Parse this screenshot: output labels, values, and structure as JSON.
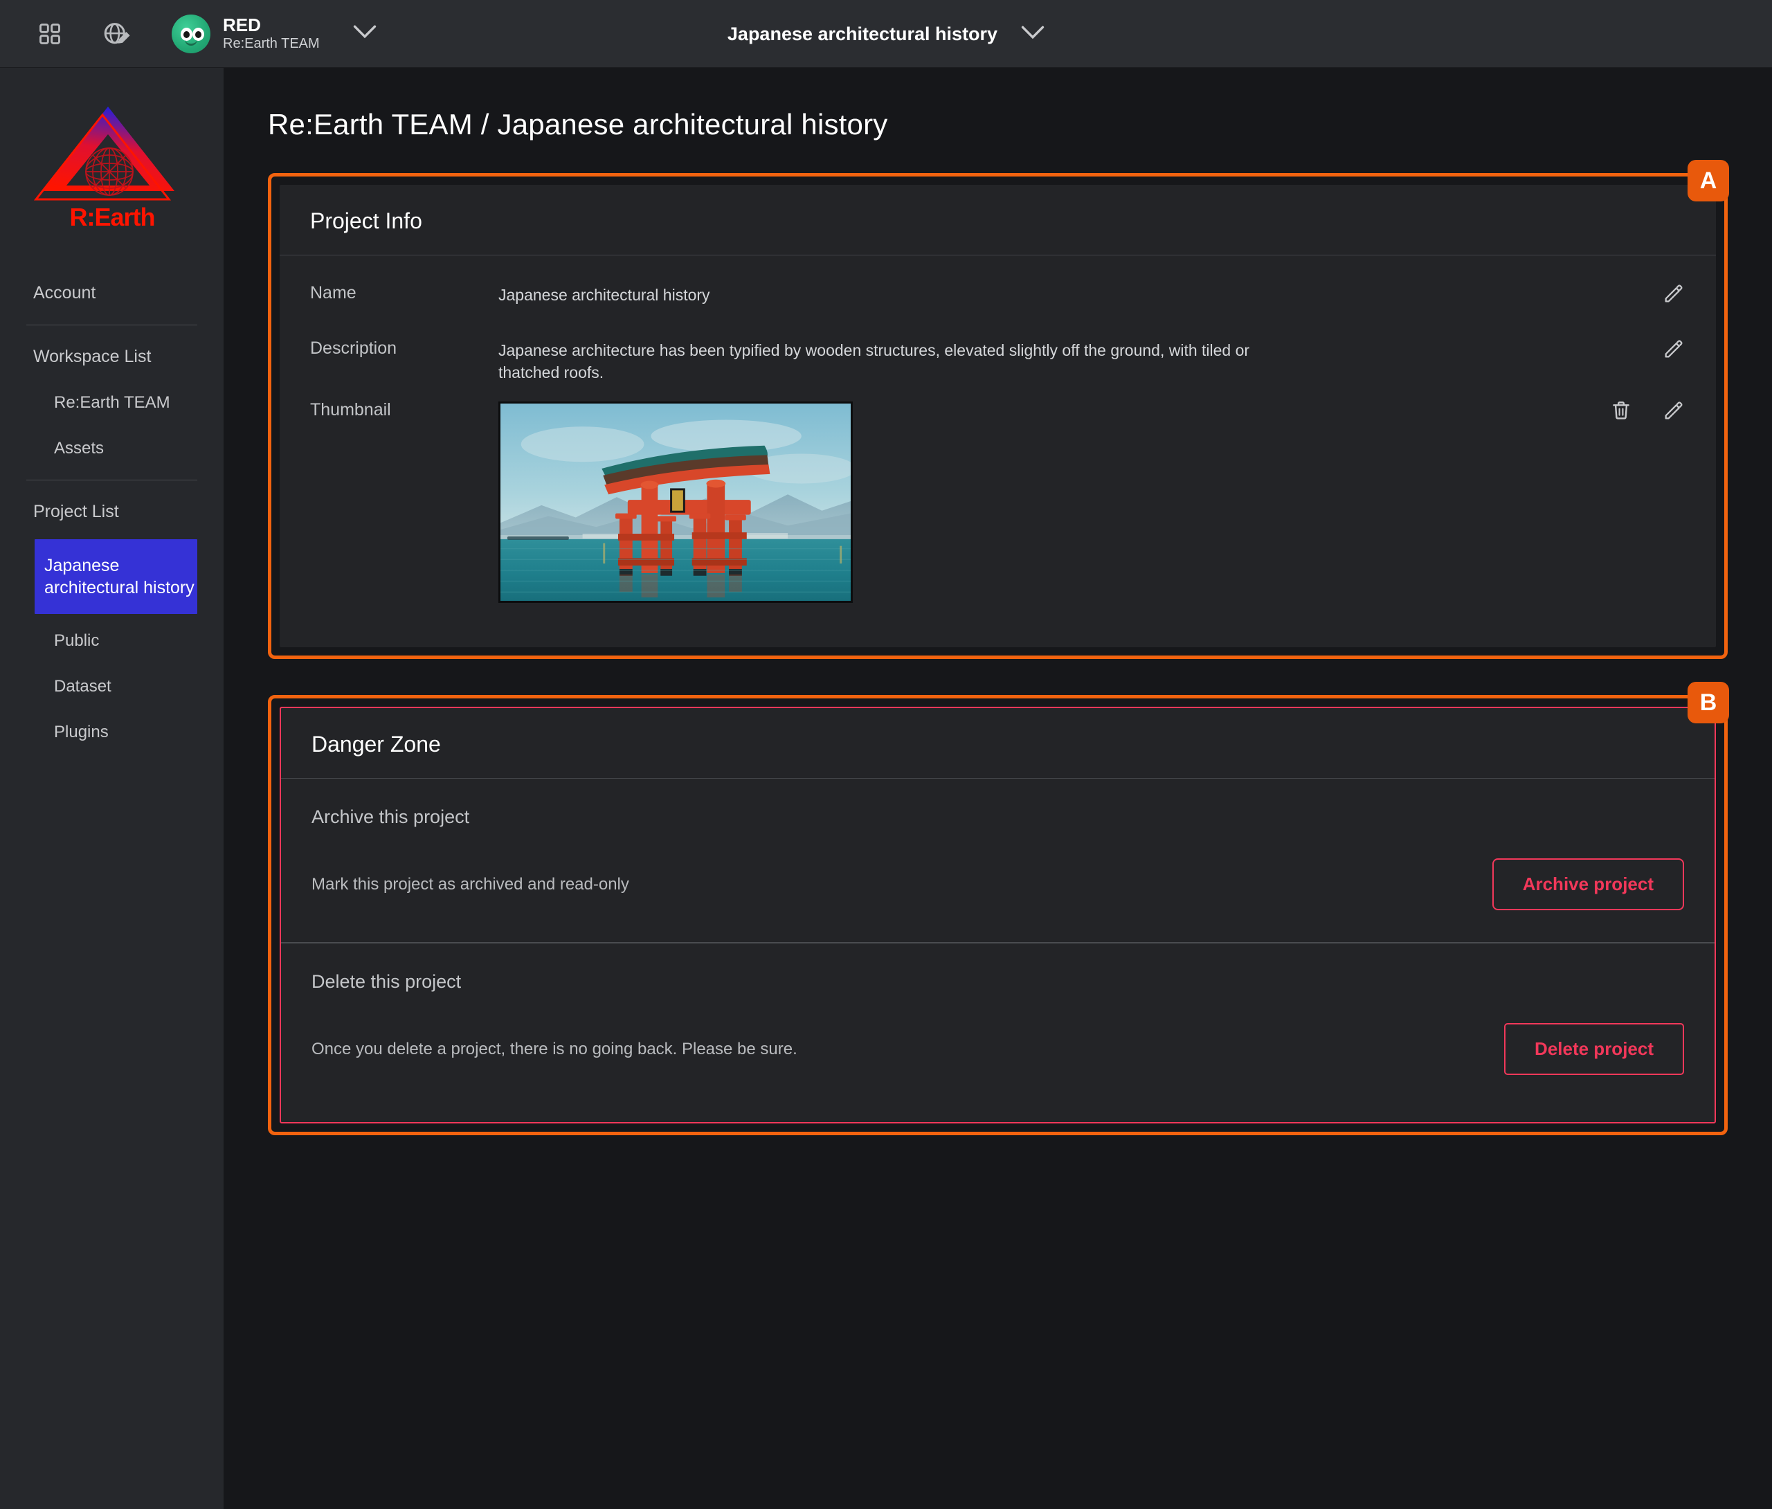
{
  "topbar": {
    "apps_icon": "grid-apps-icon",
    "globe_icon": "globe-pen-icon",
    "avatar_icon": "user-avatar-icon",
    "user_name": "RED",
    "user_team": "Re:Earth TEAM",
    "user_chevron_icon": "chevron-down-icon",
    "project_title": "Japanese architectural history",
    "project_chevron_icon": "chevron-down-icon"
  },
  "sidebar": {
    "logo_text": "R:Earth",
    "logo_icon": "reearth-logo-icon",
    "items": [
      {
        "label": "Account",
        "level": 0,
        "selected": false
      },
      {
        "label": "Workspace List",
        "level": 0,
        "selected": false
      },
      {
        "label": "Re:Earth TEAM",
        "level": 1,
        "selected": false
      },
      {
        "label": "Assets",
        "level": 1,
        "selected": false
      },
      {
        "label": "Project List",
        "level": 0,
        "selected": false
      },
      {
        "label": "Japanese architectural history",
        "level": 1,
        "selected": true
      },
      {
        "label": "Public",
        "level": 1,
        "selected": false
      },
      {
        "label": "Dataset",
        "level": 1,
        "selected": false
      },
      {
        "label": "Plugins",
        "level": 1,
        "selected": false
      }
    ]
  },
  "main": {
    "page_title": "Re:Earth TEAM / Japanese architectural history",
    "annotations": {
      "a": "A",
      "b": "B"
    },
    "project_info": {
      "title": "Project Info",
      "rows": [
        {
          "label": "Name",
          "value": "Japanese architectural history",
          "actions": [
            "edit-icon"
          ]
        },
        {
          "label": "Description",
          "value": "Japanese architecture has been typified by wooden structures, elevated slightly off the ground, with tiled or thatched roofs.",
          "actions": [
            "edit-icon"
          ]
        },
        {
          "label": "Thumbnail",
          "value": "",
          "image_alt": "torii-gate-thumbnail",
          "actions": [
            "trash-icon",
            "edit-icon"
          ]
        }
      ]
    },
    "danger_zone": {
      "title": "Danger Zone",
      "sections": [
        {
          "heading": "Archive this project",
          "text": "Mark this project as archived and read-only",
          "button": "Archive project"
        },
        {
          "heading": "Delete this project",
          "text": "Once you delete a project, there is no going back. Please be sure.",
          "button": "Delete project"
        }
      ]
    }
  },
  "colors": {
    "accent_orange": "#e8590c",
    "danger_red": "#f2385a",
    "selection_blue": "#3532d6",
    "logo_red": "#fe1400",
    "panel_bg": "#232427",
    "sidebar_bg": "#26282c",
    "topbar_bg": "#2b2d31",
    "main_bg": "#16171a"
  }
}
